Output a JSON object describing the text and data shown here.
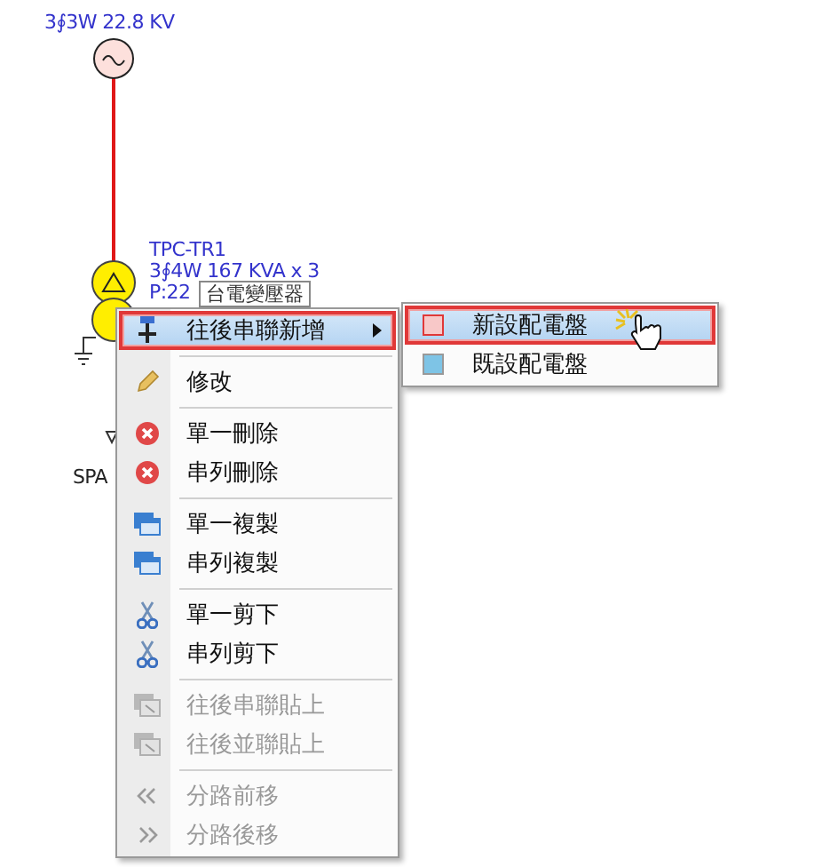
{
  "diagram": {
    "source_label": "3∮3W 22.8 KV",
    "transformer_name": "TPC-TR1",
    "transformer_rating": "3∮4W 167 KVA x 3",
    "transformer_partial": "P:22",
    "tooltip": "台電變壓器",
    "load_label": "SPA"
  },
  "context_menu": {
    "groups": [
      [
        {
          "label": "往後串聯新增",
          "selected": true,
          "disabled": false,
          "submenu": true
        }
      ],
      [
        {
          "label": "修改",
          "selected": false,
          "disabled": false,
          "submenu": false
        }
      ],
      [
        {
          "label": "單一刪除",
          "selected": false,
          "disabled": false,
          "submenu": false
        },
        {
          "label": "串列刪除",
          "selected": false,
          "disabled": false,
          "submenu": false
        }
      ],
      [
        {
          "label": "單一複製",
          "selected": false,
          "disabled": false,
          "submenu": false
        },
        {
          "label": "串列複製",
          "selected": false,
          "disabled": false,
          "submenu": false
        }
      ],
      [
        {
          "label": "單一剪下",
          "selected": false,
          "disabled": false,
          "submenu": false
        },
        {
          "label": "串列剪下",
          "selected": false,
          "disabled": false,
          "submenu": false
        }
      ],
      [
        {
          "label": "往後串聯貼上",
          "selected": false,
          "disabled": true,
          "submenu": false
        },
        {
          "label": "往後並聯貼上",
          "selected": false,
          "disabled": true,
          "submenu": false
        }
      ],
      [
        {
          "label": "分路前移",
          "selected": false,
          "disabled": true,
          "submenu": false
        },
        {
          "label": "分路後移",
          "selected": false,
          "disabled": true,
          "submenu": false
        }
      ]
    ]
  },
  "submenu": {
    "items": [
      {
        "label": "新設配電盤",
        "selected": true,
        "color": "#f8c8c8"
      },
      {
        "label": "既設配電盤",
        "selected": false,
        "color": "#7ec4e6"
      }
    ]
  }
}
